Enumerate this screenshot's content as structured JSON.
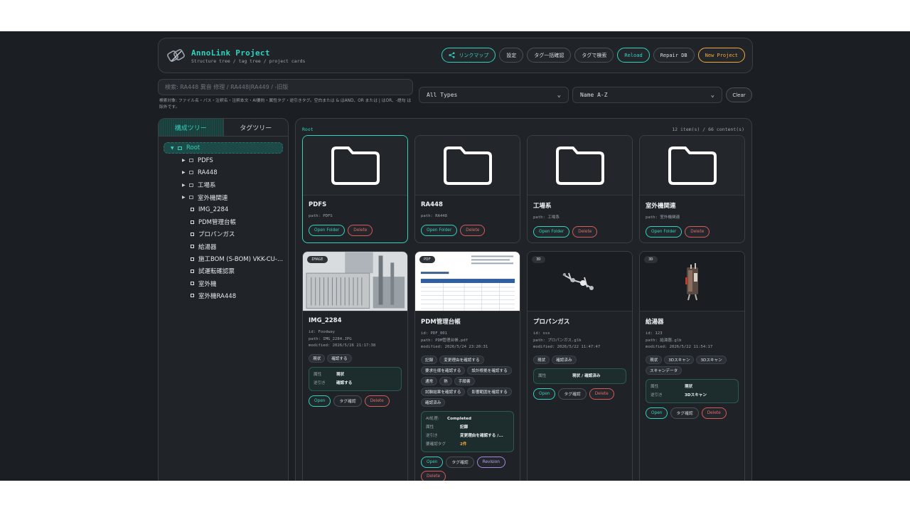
{
  "header": {
    "title": "AnnoLink Project",
    "subtitle": "Structure tree / tag tree / project cards",
    "buttons": {
      "link_map": "リンクマップ",
      "settings": "設定",
      "tag_bulk": "タグ一括確認",
      "tag_search": "タグで検索",
      "reload": "Reload",
      "repair_db": "Repair DB",
      "new_project": "New Project"
    }
  },
  "search": {
    "placeholder": "検索: RA448 異音 修理 / RA448|RA449 / -旧版",
    "hint": "検索対象: ファイル名・パス・注釈名・注釈本文・AI要約・属性タグ・逆引きタグ。空白または & はAND、OR または | はOR、-語句 は除外です。"
  },
  "filters": {
    "type": "All Types",
    "sort": "Name A-Z",
    "clear": "Clear"
  },
  "tree": {
    "tab_structure": "構成ツリー",
    "tab_tags": "タグツリー",
    "root": "Root",
    "folders": [
      "PDFS",
      "RA448",
      "工場系",
      "室外機関連"
    ],
    "files": [
      "IMG_2284",
      "PDM管理台帳",
      "プロパンガス",
      "給湯器",
      "施工BOM (S-BOM) VKK-CU-...",
      "試運転確認票",
      "室外機",
      "室外機RA448"
    ]
  },
  "main": {
    "breadcrumb": "Root",
    "count": "12 item(s) / 66 content(s)",
    "labels": {
      "open_folder": "Open Folder",
      "delete": "Delete",
      "open": "Open",
      "tag_check": "タグ確認",
      "revision": "Revision"
    },
    "folders": [
      {
        "name": "PDFS",
        "path": "path: PDFS"
      },
      {
        "name": "RA448",
        "path": "path: RA448"
      },
      {
        "name": "工場系",
        "path": "path: 工場系"
      },
      {
        "name": "室外機関連",
        "path": "path: 室外機関連"
      }
    ],
    "img": {
      "badge": "IMAGE",
      "name": "IMG_2284",
      "id": "id: Foodway",
      "path": "path: IMG_2284.JPG",
      "modified": "modified: 2026/5/26 21:17:38",
      "tags": [
        "現状",
        "確認する"
      ],
      "kv": [
        {
          "k": "属性",
          "v": "現状"
        },
        {
          "k": "逆引き",
          "v": "確認する"
        }
      ]
    },
    "pdf": {
      "badge": "PDF",
      "name": "PDM管理台帳",
      "id": "id: PDF_001",
      "path": "path: PDM管理台帳.pdf",
      "modified": "modified: 2026/5/24 23:20:31",
      "tags": [
        "記録",
        "変更理由を確認する",
        "要求仕様を確認する",
        "設計根拠を確認する",
        "通常",
        "熱",
        "手順書",
        "試験結果を確認する",
        "影響範囲を確認する",
        "確認済み"
      ],
      "kv": [
        {
          "k": "AI処理:",
          "v": "Completed"
        },
        {
          "k": "属性",
          "v": "記録"
        },
        {
          "k": "逆引き",
          "v": "変更理由を確認する /..."
        },
        {
          "k": "要確認タグ",
          "v": "2件"
        }
      ]
    },
    "propane": {
      "badge": "3D",
      "name": "プロパンガス",
      "id": "id: sss",
      "path": "path: プロパンガス.glb",
      "modified": "modified: 2026/5/22 11:47:47",
      "tags": [
        "現状",
        "確認済み"
      ],
      "kv": [
        {
          "k": "属性",
          "v": "現状 / 確認済み"
        }
      ]
    },
    "heater": {
      "badge": "3D",
      "name": "給湯器",
      "id": "id: 123",
      "path": "path: 給湯器.glb",
      "modified": "modified: 2026/5/22 11:54:17",
      "tags": [
        "現状",
        "3Dスキャン",
        "3Dスキャン",
        "スキャンデータ"
      ],
      "kv": [
        {
          "k": "属性",
          "v": "現状"
        },
        {
          "k": "逆引き",
          "v": "3Dスキャン"
        }
      ]
    }
  }
}
